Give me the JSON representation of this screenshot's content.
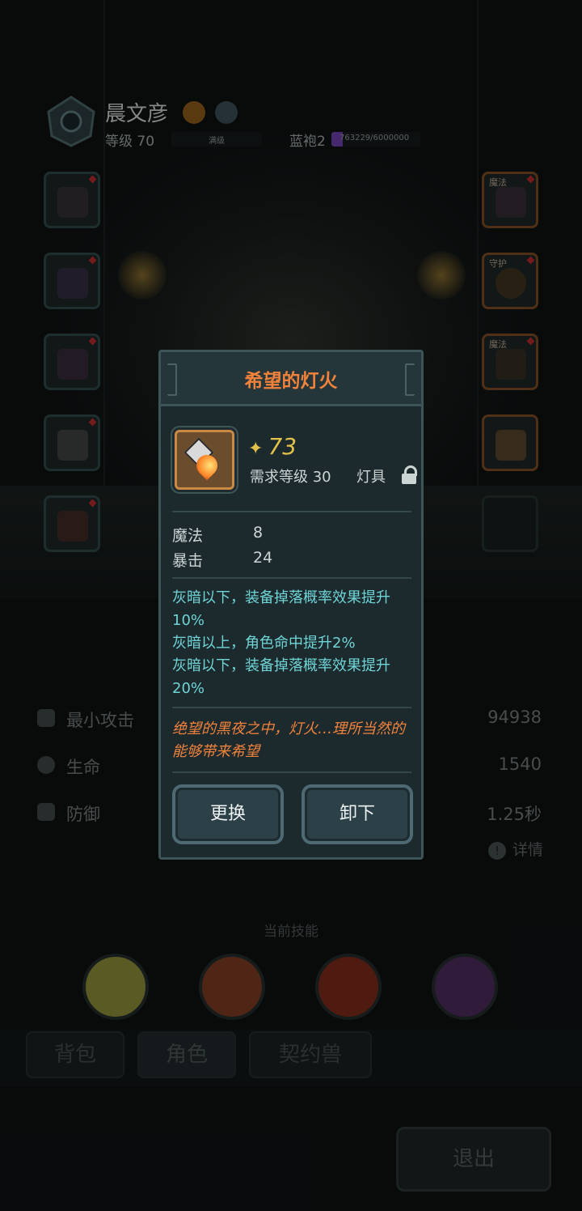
{
  "character": {
    "name": "晨文彦",
    "level_text": "等级 70",
    "level_bar_text": "满级",
    "robe_label": "蓝袍2",
    "robe_progress_text": "763229/6000000",
    "robe_progress": 0.127
  },
  "equipment_slots": {
    "left": [
      {
        "name": "helmet",
        "tag": ""
      },
      {
        "name": "armor",
        "tag": ""
      },
      {
        "name": "boots",
        "tag": ""
      },
      {
        "name": "bracer",
        "tag": ""
      },
      {
        "name": "belt",
        "tag": ""
      }
    ],
    "right": [
      {
        "name": "amulet",
        "tag": "魔法"
      },
      {
        "name": "ring",
        "tag": "守护"
      },
      {
        "name": "necklace",
        "tag": "魔法"
      },
      {
        "name": "lamp",
        "tag": ""
      }
    ]
  },
  "stats": [
    {
      "label": "最小攻击",
      "value": "94938"
    },
    {
      "label": "生命",
      "value": "1540"
    },
    {
      "label": "防御",
      "value": "1.25秒"
    }
  ],
  "details_label": "详情",
  "skills_title": "当前技能",
  "skills": [
    {
      "name": "poison-orbs",
      "color": "#8a8a3a"
    },
    {
      "name": "fire-shield",
      "color": "#7a3a22"
    },
    {
      "name": "crossed-axes",
      "color": "#7a2a1a"
    },
    {
      "name": "void-sword",
      "color": "#4a2a5a"
    }
  ],
  "tabs": [
    {
      "label": "背包"
    },
    {
      "label": "角色"
    },
    {
      "label": "契约兽"
    }
  ],
  "exit_label": "退出",
  "dialog": {
    "title": "希望的灯火",
    "power": "73",
    "requirement": "需求等级 30",
    "equip_type": "灯具",
    "attributes": [
      {
        "name": "魔法",
        "value": "8"
      },
      {
        "name": "暴击",
        "value": "24"
      }
    ],
    "affixes": [
      "灰暗以下，装备掉落概率效果提升10%",
      "灰暗以上，角色命中提升2%",
      "灰暗以下，装备掉落概率效果提升20%"
    ],
    "flavor": "绝望的黑夜之中，灯火…理所当然的能够带来希望",
    "replace_label": "更换",
    "unequip_label": "卸下"
  },
  "colors": {
    "title_orange": "#f0823c",
    "affix_cyan": "#6fd4d6",
    "power_gold": "#e2c14a",
    "dialog_bg": "#1c2a2e"
  }
}
